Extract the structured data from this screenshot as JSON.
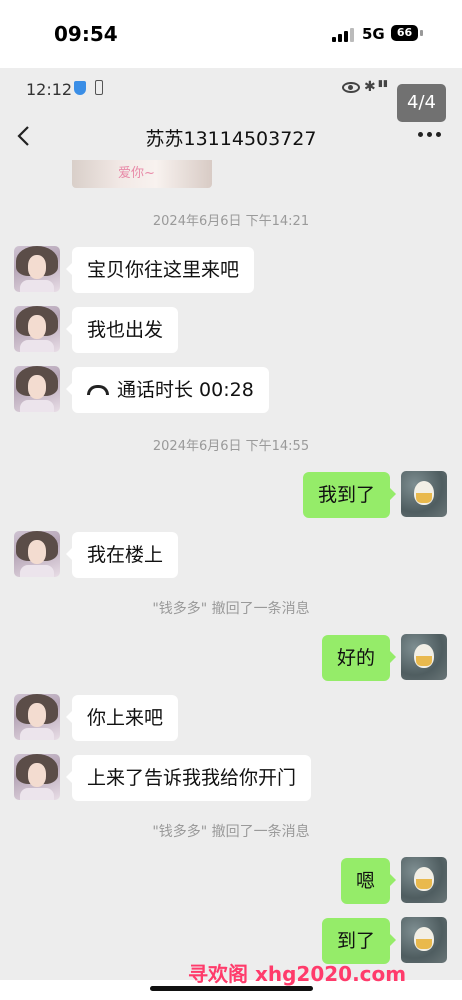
{
  "phone_status": {
    "time": "09:54",
    "network": "5G",
    "battery": "66"
  },
  "app_status": {
    "time": "12:12"
  },
  "page_indicator": "4/4",
  "chat": {
    "title": "苏苏13114503727"
  },
  "image_caption": "爱你~",
  "timestamps": [
    "2024年6月6日 下午14:21",
    "2024年6月6日 下午14:55"
  ],
  "messages": {
    "m1": "宝贝你往这里来吧",
    "m2": "我也出发",
    "m3": "通话时长 00:28",
    "m4": "我到了",
    "m5": "我在楼上",
    "m6": "好的",
    "m7": "你上来吧",
    "m8": "上来了告诉我我给你开门",
    "m9": "嗯",
    "m10": "到了"
  },
  "recall_notices": [
    "\"钱多多\" 撤回了一条消息",
    "\"钱多多\" 撤回了一条消息"
  ],
  "watermark": "寻欢阁 xhg2020.com",
  "colors": {
    "sent_bubble": "#95ec69",
    "received_bubble": "#ffffff",
    "chat_background": "#ededed",
    "watermark": "#ff3b6b"
  }
}
